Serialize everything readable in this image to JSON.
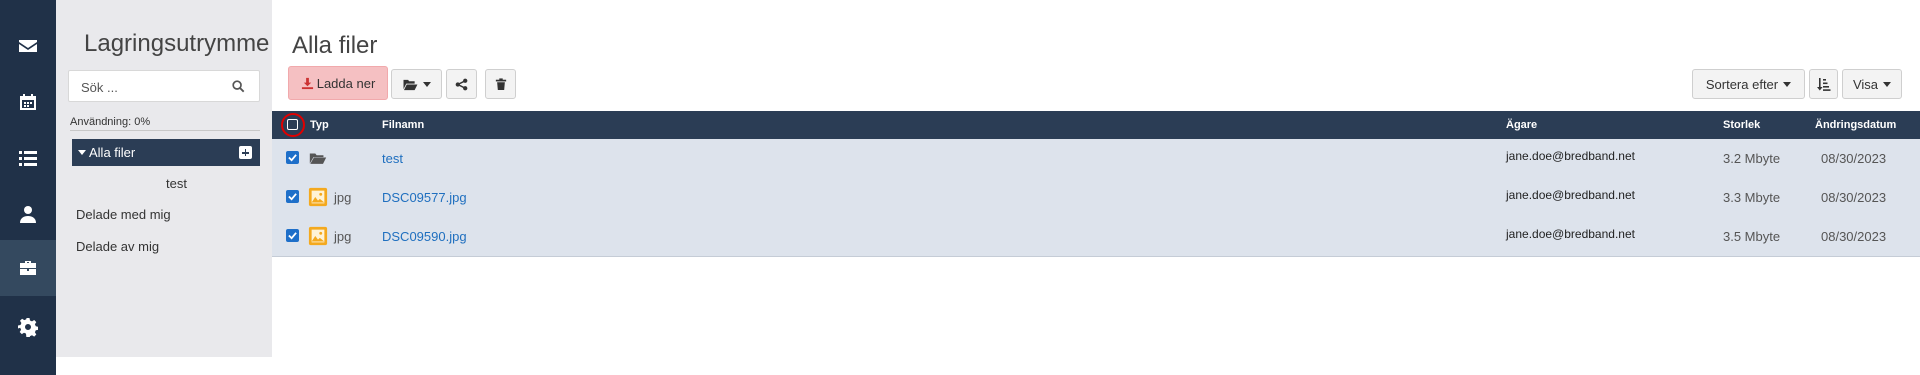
{
  "rail": {
    "items": [
      {
        "icon": "mail-icon"
      },
      {
        "icon": "calendar-icon"
      },
      {
        "icon": "list-icon"
      },
      {
        "icon": "user-icon"
      },
      {
        "icon": "briefcase-icon",
        "active": true
      },
      {
        "icon": "gear-icon"
      }
    ]
  },
  "sidebar": {
    "title": "Lagringsutrymme",
    "search_placeholder": "Sök ...",
    "usage": "Användning: 0%",
    "all_files": "Alla filer",
    "sub_folder": "test",
    "shared_with_me": "Delade med mig",
    "shared_by_me": "Delade av mig"
  },
  "main": {
    "title": "Alla filer",
    "download_label": "Ladda ner",
    "sort_label": "Sortera efter",
    "view_label": "Visa"
  },
  "table": {
    "headers": {
      "type": "Typ",
      "filename": "Filnamn",
      "owner": "Ägare",
      "size": "Storlek",
      "modified": "Ändringsdatum"
    },
    "rows": [
      {
        "type_icon": "folder-icon",
        "type": "",
        "filename": "test",
        "owner": "jane.doe@bredband.net",
        "size": "3.2 Mbyte",
        "modified": "08/30/2023",
        "checked": true
      },
      {
        "type_icon": "image-file-icon",
        "type": "jpg",
        "filename": "DSC09577.jpg",
        "owner": "jane.doe@bredband.net",
        "size": "3.3 Mbyte",
        "modified": "08/30/2023",
        "checked": true
      },
      {
        "type_icon": "image-file-icon",
        "type": "jpg",
        "filename": "DSC09590.jpg",
        "owner": "jane.doe@bredband.net",
        "size": "3.5 Mbyte",
        "modified": "08/30/2023",
        "checked": true
      }
    ]
  },
  "colors": {
    "rail_bg": "#203148",
    "header_bg": "#2b3d55",
    "row_bg": "#dde3ec",
    "link": "#1f6fbf",
    "download_bg": "#f5c0c2",
    "highlight_ring": "#e00000"
  }
}
